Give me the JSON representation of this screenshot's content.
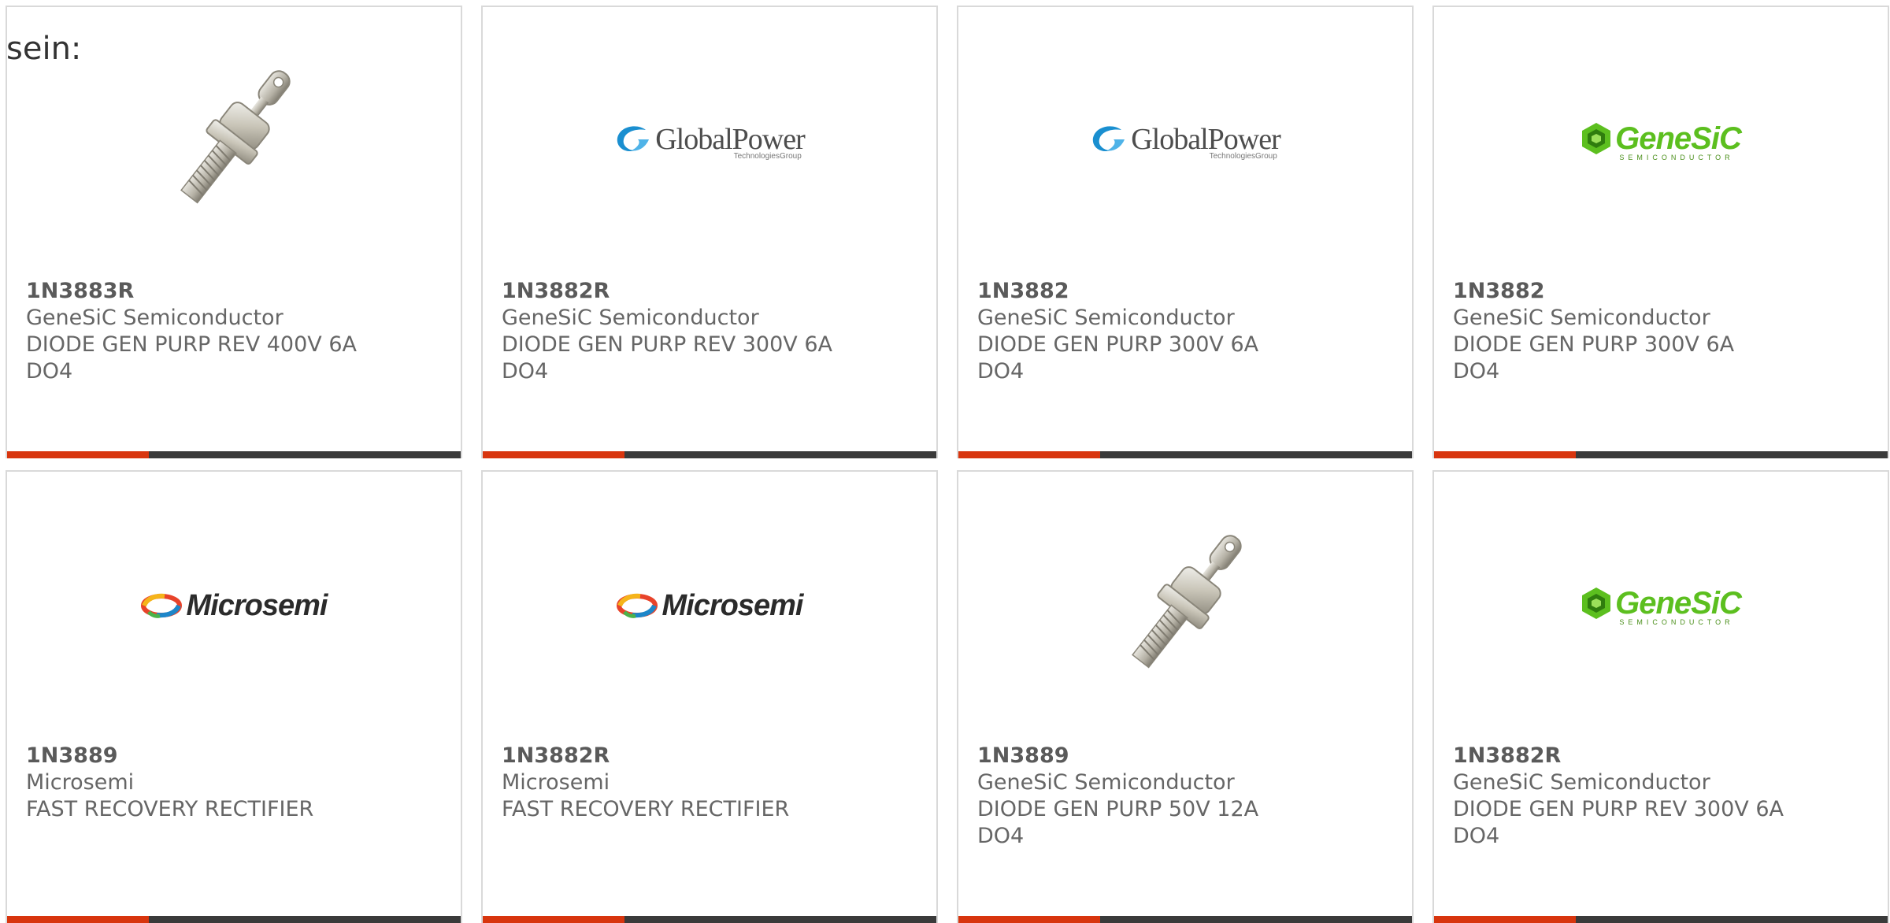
{
  "intro_text": "sein:",
  "colors": {
    "accent": "#d8350e",
    "bar": "#3a3a3a",
    "text": "#666666",
    "border": "#d9d9d9"
  },
  "products": [
    {
      "part_number": "1N3883R",
      "manufacturer": "GeneSiC Semiconductor",
      "description_lines": [
        "DIODE GEN PURP REV 400V 6A",
        "DO4"
      ],
      "image": "stud-diode-photo"
    },
    {
      "part_number": "1N3882R",
      "manufacturer": "GeneSiC Semiconductor",
      "description_lines": [
        "DIODE GEN PURP REV 300V 6A",
        "DO4"
      ],
      "image": "globalpower-logo",
      "logo_text": "GlobalPower",
      "logo_subtext": "TechnologiesGroup"
    },
    {
      "part_number": "1N3882",
      "manufacturer": "GeneSiC Semiconductor",
      "description_lines": [
        "DIODE GEN PURP 300V 6A DO4"
      ],
      "image": "globalpower-logo",
      "logo_text": "GlobalPower",
      "logo_subtext": "TechnologiesGroup"
    },
    {
      "part_number": "1N3882",
      "manufacturer": "GeneSiC Semiconductor",
      "description_lines": [
        "DIODE GEN PURP 300V 6A DO4"
      ],
      "image": "genesic-logo",
      "logo_text": "GeneSiC",
      "logo_subtext": "SEMICONDUCTOR"
    },
    {
      "part_number": "1N3889",
      "manufacturer": "Microsemi",
      "description_lines": [
        "FAST RECOVERY RECTIFIER"
      ],
      "image": "microsemi-logo",
      "logo_text": "Microsemi"
    },
    {
      "part_number": "1N3882R",
      "manufacturer": "Microsemi",
      "description_lines": [
        "FAST RECOVERY RECTIFIER"
      ],
      "image": "microsemi-logo",
      "logo_text": "Microsemi"
    },
    {
      "part_number": "1N3889",
      "manufacturer": "GeneSiC Semiconductor",
      "description_lines": [
        "DIODE GEN PURP 50V 12A DO4"
      ],
      "image": "stud-diode-photo"
    },
    {
      "part_number": "1N3882R",
      "manufacturer": "GeneSiC Semiconductor",
      "description_lines": [
        "DIODE GEN PURP REV 300V 6A",
        "DO4"
      ],
      "image": "genesic-logo",
      "logo_text": "GeneSiC",
      "logo_subtext": "SEMICONDUCTOR"
    }
  ]
}
